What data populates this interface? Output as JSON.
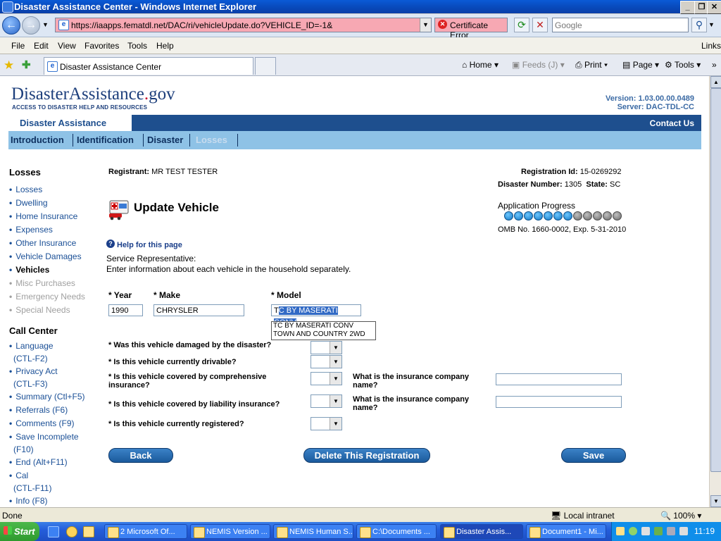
{
  "window": {
    "title": "Disaster Assistance Center - Windows Internet Explorer"
  },
  "addressbar": {
    "url": "https://iaapps.fematdl.net/DAC/ri/vehicleUpdate.do?VEHICLE_ID=-1&",
    "cert_error": "Certificate Error",
    "search_placeholder": "Google"
  },
  "menu": {
    "items": [
      "File",
      "Edit",
      "View",
      "Favorites",
      "Tools",
      "Help"
    ],
    "links": "Links"
  },
  "tabbar": {
    "tab_title": "Disaster Assistance Center",
    "home": "Home",
    "feeds": "Feeds (J)",
    "print": "Print",
    "page": "Page",
    "tools": "Tools"
  },
  "site": {
    "logo_main": "DisasterAssistance",
    "logo_dot": ".",
    "logo_gov": "gov",
    "logo_tagline": "ACCESS TO DISASTER HELP AND RESOURCES",
    "version": "Version: 1.03.00.00.0489",
    "server": "Server: DAC-TDL-CC",
    "brand": "Disaster Assistance",
    "contact": "Contact Us",
    "tabs": [
      "Introduction",
      "Identification",
      "Disaster",
      "Losses"
    ]
  },
  "leftnav": {
    "losses_heading": "Losses",
    "losses_items": [
      {
        "label": "Losses",
        "state": "link"
      },
      {
        "label": "Dwelling",
        "state": "link"
      },
      {
        "label": "Home Insurance",
        "state": "link"
      },
      {
        "label": "Expenses",
        "state": "link"
      },
      {
        "label": "Other Insurance",
        "state": "link"
      },
      {
        "label": "Vehicle Damages",
        "state": "link"
      },
      {
        "label": "Vehicles",
        "state": "active"
      },
      {
        "label": "Misc Purchases",
        "state": "disabled"
      },
      {
        "label": "Emergency Needs",
        "state": "disabled"
      },
      {
        "label": "Special Needs",
        "state": "disabled"
      }
    ],
    "call_heading": "Call Center",
    "call_items": [
      {
        "label": "Language",
        "sub": "(CTL-F2)"
      },
      {
        "label": "Privacy Act",
        "sub": "(CTL-F3)"
      },
      {
        "label": "Summary (Ctl+F5)",
        "sub": ""
      },
      {
        "label": "Referrals (F6)",
        "sub": ""
      },
      {
        "label": "Comments (F9)",
        "sub": ""
      },
      {
        "label": "Save Incomplete",
        "sub": "(F10)"
      },
      {
        "label": "End (Alt+F11)",
        "sub": ""
      },
      {
        "label": "Cal",
        "sub": "(CTL-F11)"
      },
      {
        "label": "Info (F8)",
        "sub": ""
      }
    ]
  },
  "main": {
    "registrant_label": "Registrant:",
    "registrant_value": "MR TEST TESTER",
    "regid_label": "Registration Id:",
    "regid_value": "15-0269292",
    "disaster_label": "Disaster Number:",
    "disaster_value": "1305",
    "state_label": "State:",
    "state_value": "SC",
    "title": "Update Vehicle",
    "progress_label": "Application Progress",
    "progress": {
      "completed": 7,
      "total": 12
    },
    "omb": "OMB No. 1660-0002, Exp. 5-31-2010",
    "help": "Help for this page",
    "service_rep": "Service Representative:",
    "instructions": "Enter information about each vehicle in the household separately.",
    "year_label": "* Year",
    "make_label": "* Make",
    "model_label": "* Model",
    "year_value": "1990",
    "make_value": "CHRYSLER",
    "model_value_prefix": "T",
    "model_value_selected": "C BY MASERATI CONV",
    "suggestions": [
      "TC BY MASERATI CONV",
      "TOWN AND COUNTRY 2WD"
    ],
    "q_damaged": "* Was this vehicle damaged by the disaster?",
    "q_drivable": "* Is this vehicle currently drivable?",
    "q_comprehensive": "* Is this vehicle covered by comprehensive insurance?",
    "q_liability": "* Is this vehicle covered by liability insurance?",
    "q_registered": "* Is this vehicle currently registered?",
    "ins_company_label": "What is the insurance company name?",
    "btn_back": "Back",
    "btn_delete": "Delete This Registration",
    "btn_save": "Save"
  },
  "statusbar": {
    "status": "Done",
    "zone": "Local intranet",
    "zoom": "100%"
  },
  "taskbar": {
    "start": "Start",
    "items": [
      "2 Microsoft Of...",
      "NEMIS Version ...",
      "NEMIS Human S...",
      "C:\\Documents ...",
      "Disaster Assis...",
      "Document1 - Mi..."
    ],
    "clock": "11:19"
  }
}
